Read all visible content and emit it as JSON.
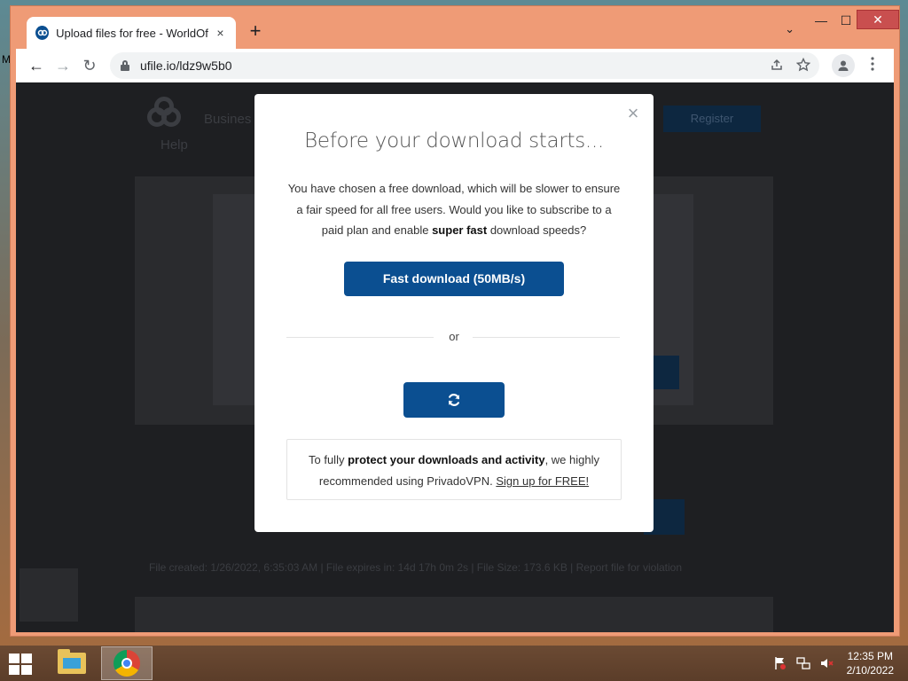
{
  "desktop": {
    "stray_text": "M"
  },
  "browser": {
    "tab": {
      "title": "Upload files for free - WorldOfW",
      "favicon": "ufile-logo-icon",
      "close": "×"
    },
    "new_tab": "+",
    "tab_dropdown": "⌄",
    "window_controls": {
      "minimize": "—",
      "maximize": "☐",
      "close": "✕"
    },
    "toolbar": {
      "back": "←",
      "forward": "→",
      "reload": "↻",
      "url": "ufile.io/ldz9w5b0"
    }
  },
  "page_bg": {
    "help": "Help",
    "business": "Busines",
    "register": "Register",
    "info": "File created: 1/26/2022, 6:35:03 AM  |  File expires in: 14d 17h 0m 2s  |  File Size: 173.6 KB  |  Report file for violation"
  },
  "modal": {
    "close": "×",
    "title": "Before your download starts...",
    "text_before": "You have chosen a free download, which will be slower to ensure a fair speed for all free users. Would you like to subscribe to a paid plan and enable ",
    "text_bold": "super fast",
    "text_after": " download speeds?",
    "fast_button": "Fast download (50MB/s)",
    "or": "or",
    "refresh_icon": "refresh-icon",
    "vpn_before": "To fully ",
    "vpn_bold": "protect your downloads and activity",
    "vpn_middle": ", we highly recommended using PrivadoVPN. ",
    "vpn_link": "Sign up for FREE!"
  },
  "taskbar": {
    "time": "12:35 PM",
    "date": "2/10/2022",
    "tray_icons": [
      "action-center-flag-icon",
      "network-icon",
      "volume-muted-icon"
    ]
  },
  "colors": {
    "accent": "#0b4f91",
    "window_frame": "#ef9b76",
    "overlay": "#1e1f22"
  }
}
